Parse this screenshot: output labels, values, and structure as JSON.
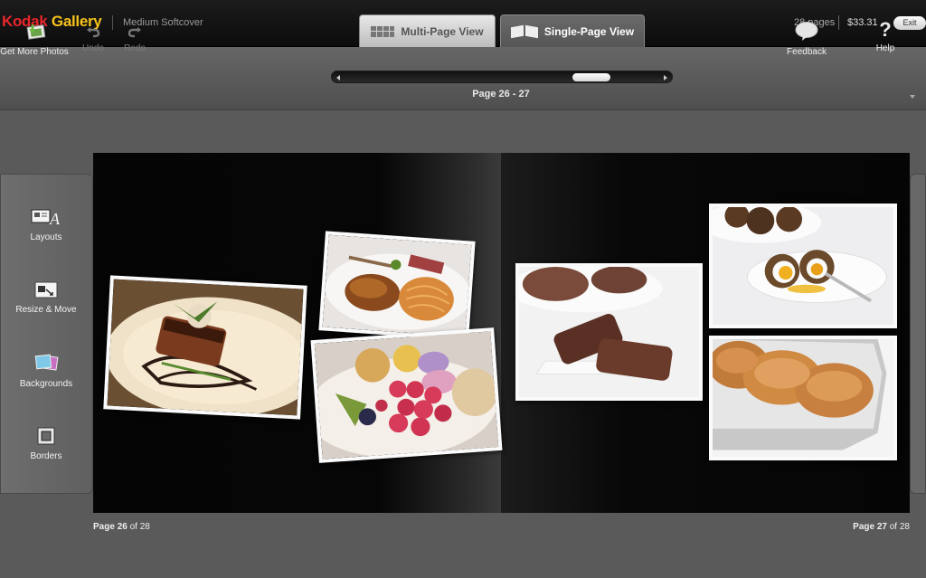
{
  "header": {
    "brand_part1": "Kodak",
    "brand_part2": "Gallery",
    "product": "Medium Softcover",
    "tabs": [
      {
        "label": "Multi-Page View",
        "icon": "grid-icon",
        "active": false
      },
      {
        "label": "Single-Page View",
        "icon": "open-book-icon",
        "active": true
      }
    ],
    "page_count": "28 pages",
    "price": "$33.31",
    "exit_label": "Exit"
  },
  "toolbar": {
    "get_photos_label": "Get More Photos",
    "undo_label": "Undo",
    "redo_label": "Redo",
    "feedback_label": "Feedback",
    "help_label": "Help",
    "help_glyph": "?",
    "page_range": "Page 26 - 27"
  },
  "sidebar": {
    "items": [
      {
        "label": "Layouts",
        "icon": "layouts-icon"
      },
      {
        "label": "Resize & Move",
        "icon": "resize-move-icon"
      },
      {
        "label": "Backgrounds",
        "icon": "backgrounds-icon"
      },
      {
        "label": "Borders",
        "icon": "borders-icon"
      }
    ]
  },
  "footer": {
    "left_prefix": "Page",
    "left_num": "26",
    "left_suffix": "of 28",
    "right_prefix": "Page",
    "right_num": "27",
    "right_suffix": "of 28"
  },
  "colors": {
    "brand_red": "#e8262a",
    "brand_yellow": "#f6c21b",
    "active_tab": "#5a5a5a",
    "inactive_tab": "#d0d0d0"
  }
}
